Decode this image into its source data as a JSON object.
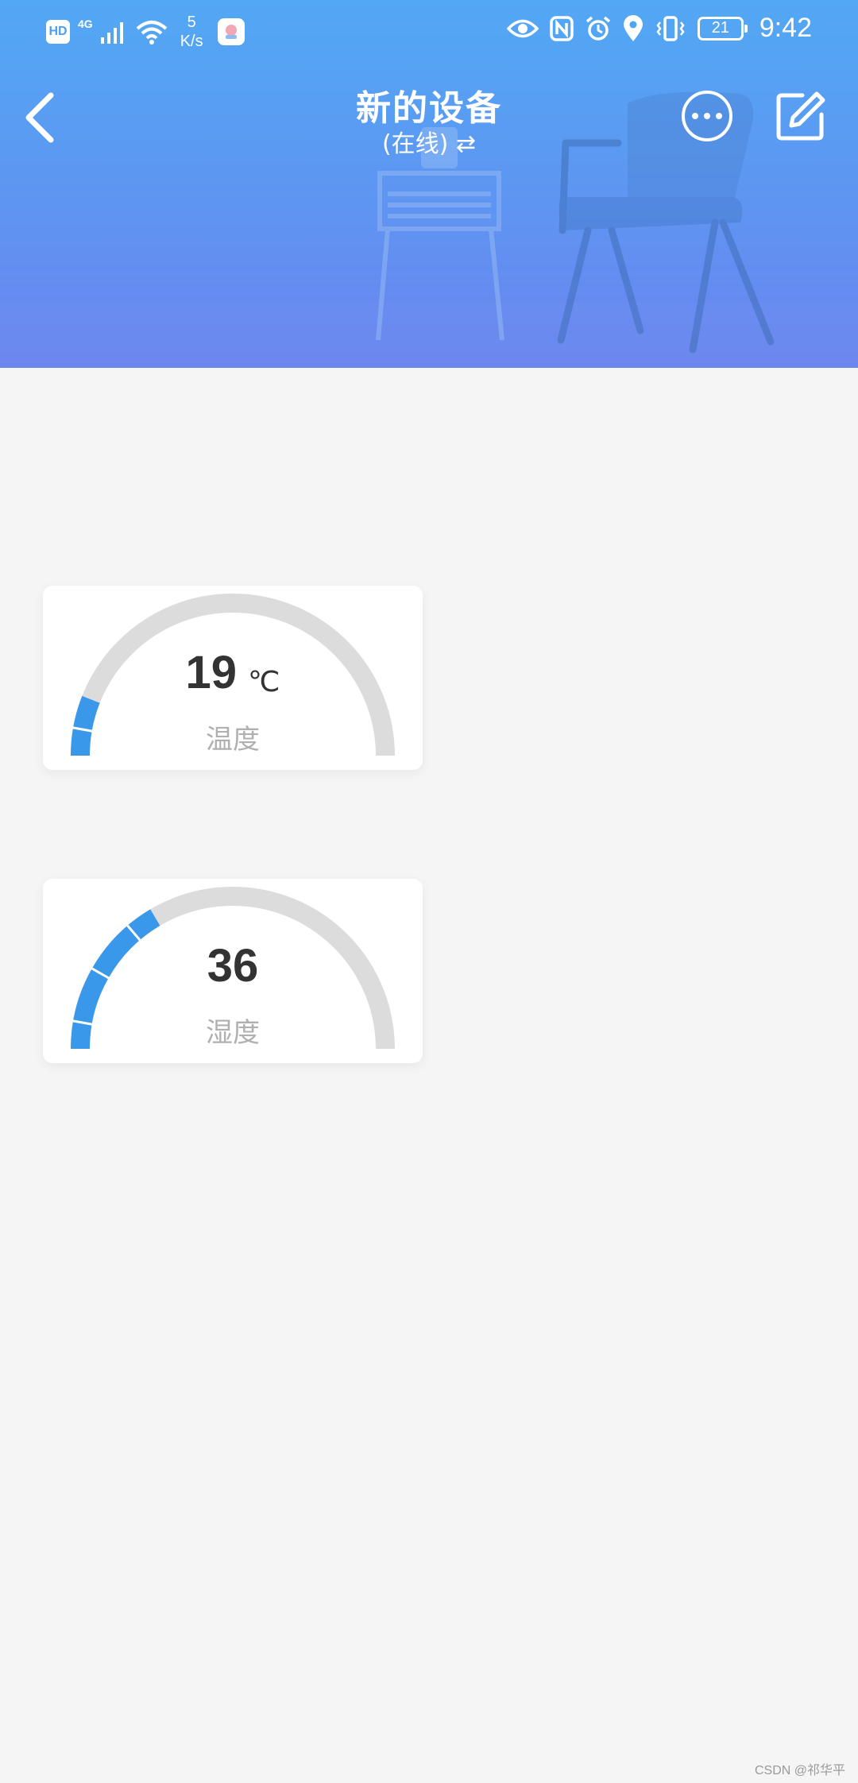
{
  "status_bar": {
    "hd": "HD",
    "network": "4G",
    "speed_value": "5",
    "speed_unit": "K/s",
    "battery": "21",
    "time": "9:42"
  },
  "header": {
    "title": "新的设备",
    "subtitle": "(在线) ⇄"
  },
  "gauges": [
    {
      "value": "19",
      "unit": "℃",
      "label": "温度",
      "fill_fraction": 0.12
    },
    {
      "value": "36",
      "unit": "",
      "label": "湿度",
      "fill_fraction": 0.33
    }
  ],
  "colors": {
    "accent": "#3a98ea",
    "track": "#dcdcdc",
    "header_top": "#52a8f4",
    "header_bottom": "#6b84ef",
    "background": "#f5f5f5"
  },
  "watermark": "CSDN @祁华平"
}
